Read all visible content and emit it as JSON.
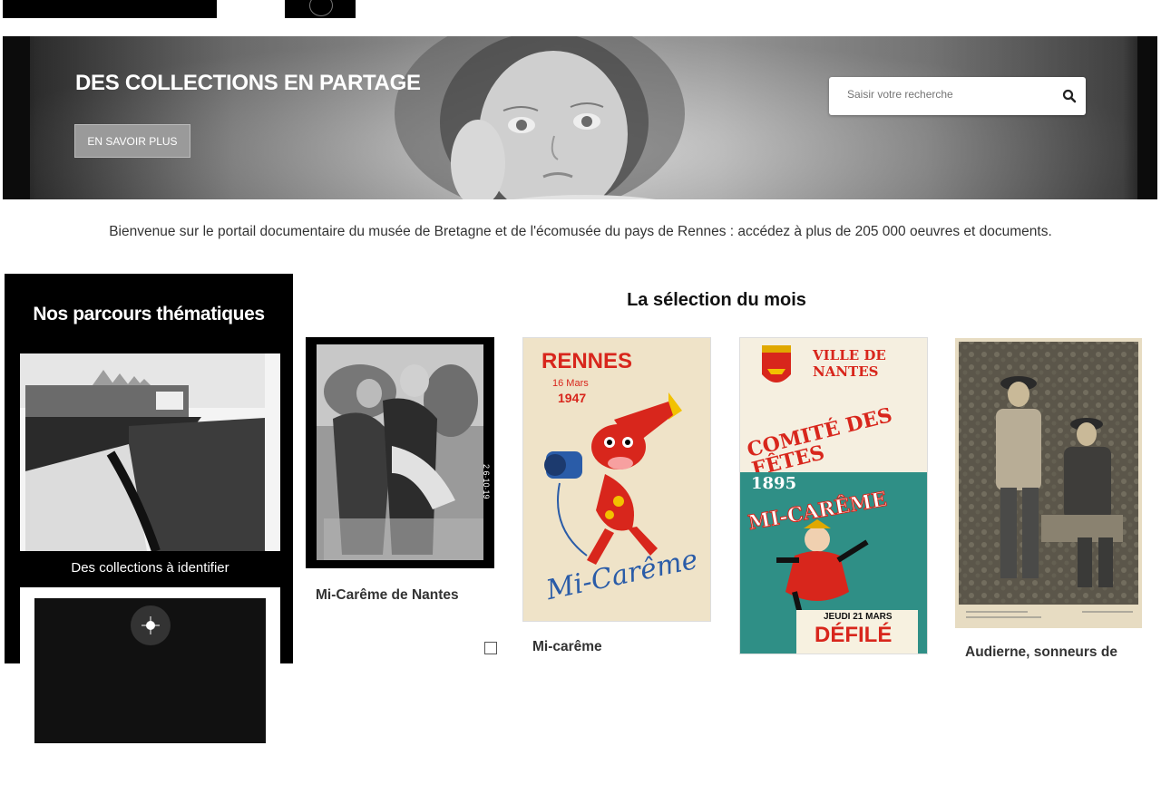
{
  "hero": {
    "title": "DES COLLECTIONS EN PARTAGE",
    "button_label": "EN SAVOIR PLUS",
    "search_placeholder": "Saisir votre recherche"
  },
  "welcome_text": "Bienvenue sur le portail documentaire du musée de Bretagne et de l'écomusée du pays de Rennes : accédez à plus de 205 000 oeuvres et documents.",
  "sidebar": {
    "title": "Nos parcours thématiques",
    "items": [
      {
        "label": "Des collections à identifier"
      },
      {
        "label": ""
      }
    ]
  },
  "selection": {
    "title": "La sélection du mois",
    "items": [
      {
        "label": "Mi-Carême de Nantes"
      },
      {
        "label": "Mi-carême",
        "poster_city": "RENNES",
        "poster_date": "16 Mars",
        "poster_year": "1947",
        "poster_script": "Mi-Carême"
      },
      {
        "label": "",
        "poster_city": "VILLE DE NANTES",
        "poster_heading": "COMITÉ DES FÊTES",
        "poster_year": "1895",
        "poster_banner": "MI-CARÊME",
        "poster_date": "JEUDI 21 MARS",
        "poster_event": "DÉFILÉ"
      },
      {
        "label": "Audierne, sonneurs de"
      }
    ]
  },
  "colors": {
    "sidebar_bg": "#000000",
    "poster_red": "#d8261c",
    "poster_cream": "#efe3c8"
  }
}
